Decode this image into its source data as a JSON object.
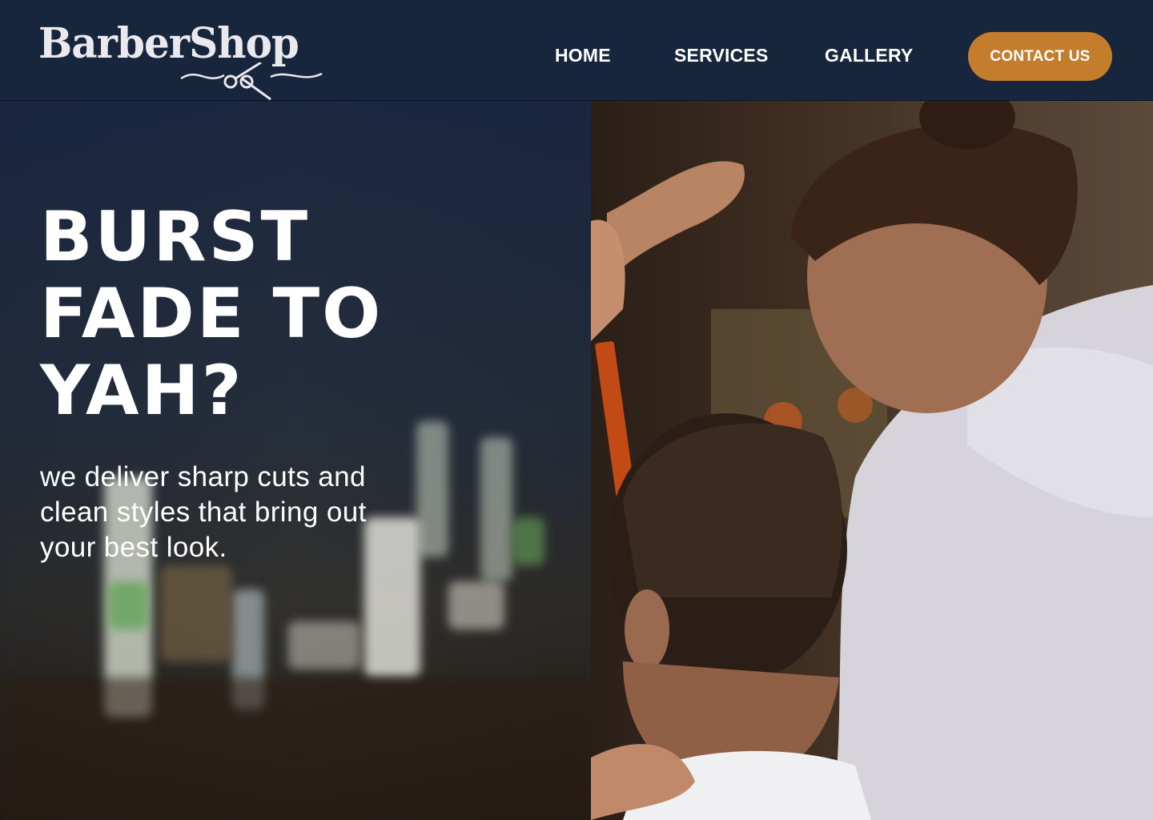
{
  "brand": {
    "logo_text": "BarberShop"
  },
  "nav": {
    "home": "HOME",
    "services": "SERVICES",
    "gallery": "GALLERY",
    "contact": "CONTACT US"
  },
  "hero": {
    "headline_lines": [
      "BURST",
      "FADE TO",
      "YAH?"
    ],
    "subline": "we deliver sharp cuts and clean styles that bring out your best look."
  },
  "colors": {
    "header_bg": "#17253d",
    "accent": "#c47d2c",
    "text": "#ffffff"
  },
  "icons": [
    "scissors-ornament-icon"
  ]
}
